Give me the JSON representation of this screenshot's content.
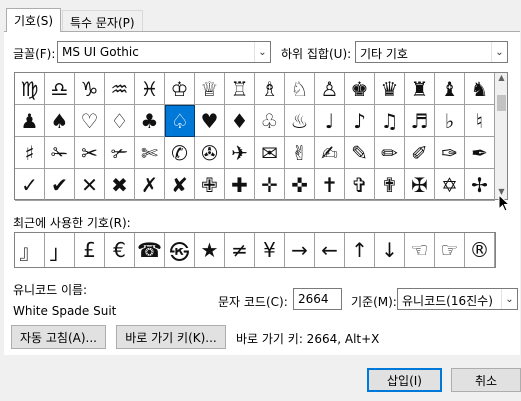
{
  "tabs": [
    {
      "label": "기호(S)"
    },
    {
      "label": "특수 문자(P)"
    }
  ],
  "font": {
    "label": "글꼴(F):",
    "value": "MS UI Gothic"
  },
  "subset": {
    "label": "하위 집합(U):",
    "value": "기타 기호"
  },
  "symbols": [
    [
      "♍",
      "♎",
      "♑",
      "♒",
      "♓",
      "♔",
      "♕",
      "♖",
      "♗",
      "♘",
      "♙",
      "♚",
      "♛",
      "♜",
      "♝",
      "♞"
    ],
    [
      "♟",
      "♠",
      "♡",
      "♢",
      "♣",
      "♤",
      "♥",
      "♦",
      "♧",
      "♨",
      "♩",
      "♪",
      "♫",
      "♬",
      "♭",
      "♮"
    ],
    [
      "♯",
      "✁",
      "✂",
      "✃",
      "✄",
      "✆",
      "✇",
      "✈",
      "✉",
      "✌",
      "✍",
      "✎",
      "✏",
      "✐",
      "✑",
      "✒"
    ],
    [
      "✓",
      "✔",
      "✕",
      "✖",
      "✗",
      "✘",
      "✙",
      "✚",
      "✛",
      "✜",
      "✝",
      "✞",
      "✟",
      "✠",
      "✡",
      "✢"
    ]
  ],
  "selected_symbol": "♤",
  "recent": {
    "label": "최근에 사용한 기호(R):",
    "items": [
      "』",
      "」",
      "£",
      "€",
      "☎",
      "㉿",
      "★",
      "≠",
      "¥",
      "→",
      "←",
      "↑",
      "↓",
      "☜",
      "☞",
      "®"
    ]
  },
  "unicode_name": {
    "label": "유니코드 이름:",
    "value": "White Spade Suit"
  },
  "char_code": {
    "label": "문자 코드(C):",
    "value": "2664"
  },
  "from": {
    "label": "기준(M):",
    "value": "유니코드(16진수)"
  },
  "buttons": {
    "autocorrect": "자동 고침(A)...",
    "shortcut_key": "바로 가기 키(K)...",
    "insert": "삽입(I)",
    "cancel": "취소"
  },
  "shortcut_text": "바로 가기 키: 2664, Alt+X"
}
